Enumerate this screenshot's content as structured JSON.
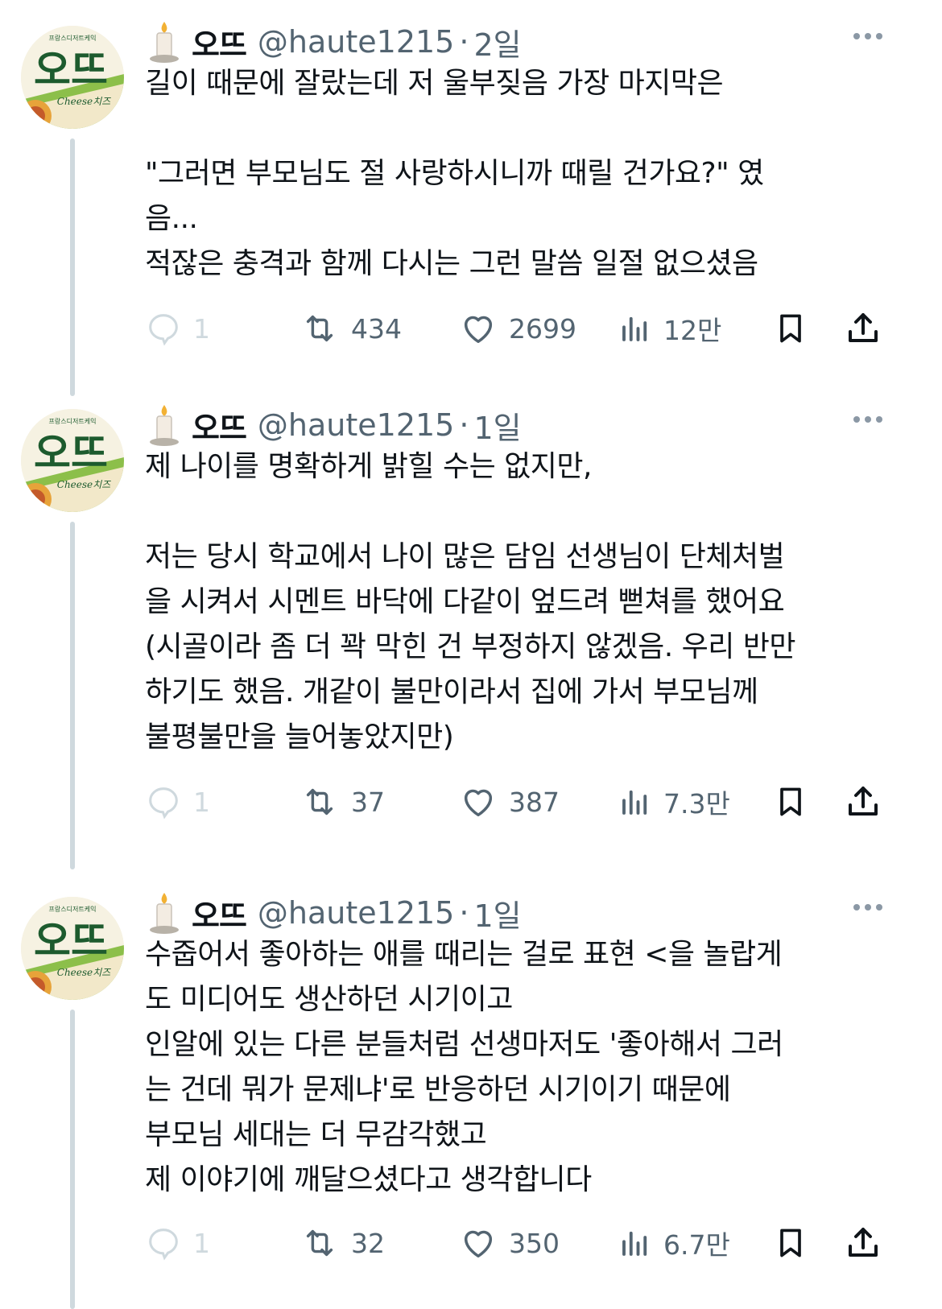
{
  "tweets": [
    {
      "name": "오뜨",
      "handle": "@haute1215",
      "separator": "·",
      "time": "2일",
      "text": "길이 때문에 잘랐는데 저 울부짖음 가장 마지막은\n\n\"그러면 부모님도 절 사랑하시니까 때릴 건가요?\" 였\n음...\n적잖은 충격과 함께 다시는 그런 말씀 일절 없으셨음",
      "replies": "1",
      "retweets": "434",
      "likes": "2699",
      "views": "12만"
    },
    {
      "name": "오뜨",
      "handle": "@haute1215",
      "separator": "·",
      "time": "1일",
      "text": "제 나이를 명확하게 밝힐 수는 없지만,\n\n저는 당시 학교에서 나이 많은 담임 선생님이 단체처벌\n을 시켜서 시멘트 바닥에 다같이 엎드려 뻗쳐를 했어요\n(시골이라 좀 더 꽉 막힌 건 부정하지 않겠음. 우리 반만\n하기도 했음. 개같이 불만이라서 집에 가서 부모님께\n불평불만을 늘어놓았지만)",
      "replies": "1",
      "retweets": "37",
      "likes": "387",
      "views": "7.3만"
    },
    {
      "name": "오뜨",
      "handle": "@haute1215",
      "separator": "·",
      "time": "1일",
      "text": "수줍어서 좋아하는 애를 때리는 걸로 표현 <을 놀랍게\n도 미디어도 생산하던 시기이고\n인알에 있는 다른 분들처럼 선생마저도 '좋아해서 그러\n는 건데 뭐가 문제냐'로 반응하던 시기이기 때문에\n부모님 세대는 더 무감각했고\n제 이야기에 깨달으셨다고 생각합니다",
      "replies": "1",
      "retweets": "32",
      "likes": "350",
      "views": "6.7만"
    }
  ],
  "avatar": {
    "logo_text": "오뜨",
    "sub_text": "Cheese치즈",
    "top_text": "프랑스디저트케익"
  },
  "icons": {
    "reply": "reply-icon",
    "retweet": "retweet-icon",
    "like": "heart-icon",
    "views": "views-icon",
    "bookmark": "bookmark-icon",
    "share": "share-icon",
    "more": "more-icon",
    "badge": "candle-icon"
  },
  "colors": {
    "text": "#0f1419",
    "muted": "#536471",
    "dim": "#cfd9de",
    "logo_green": "#1d5b2e"
  }
}
